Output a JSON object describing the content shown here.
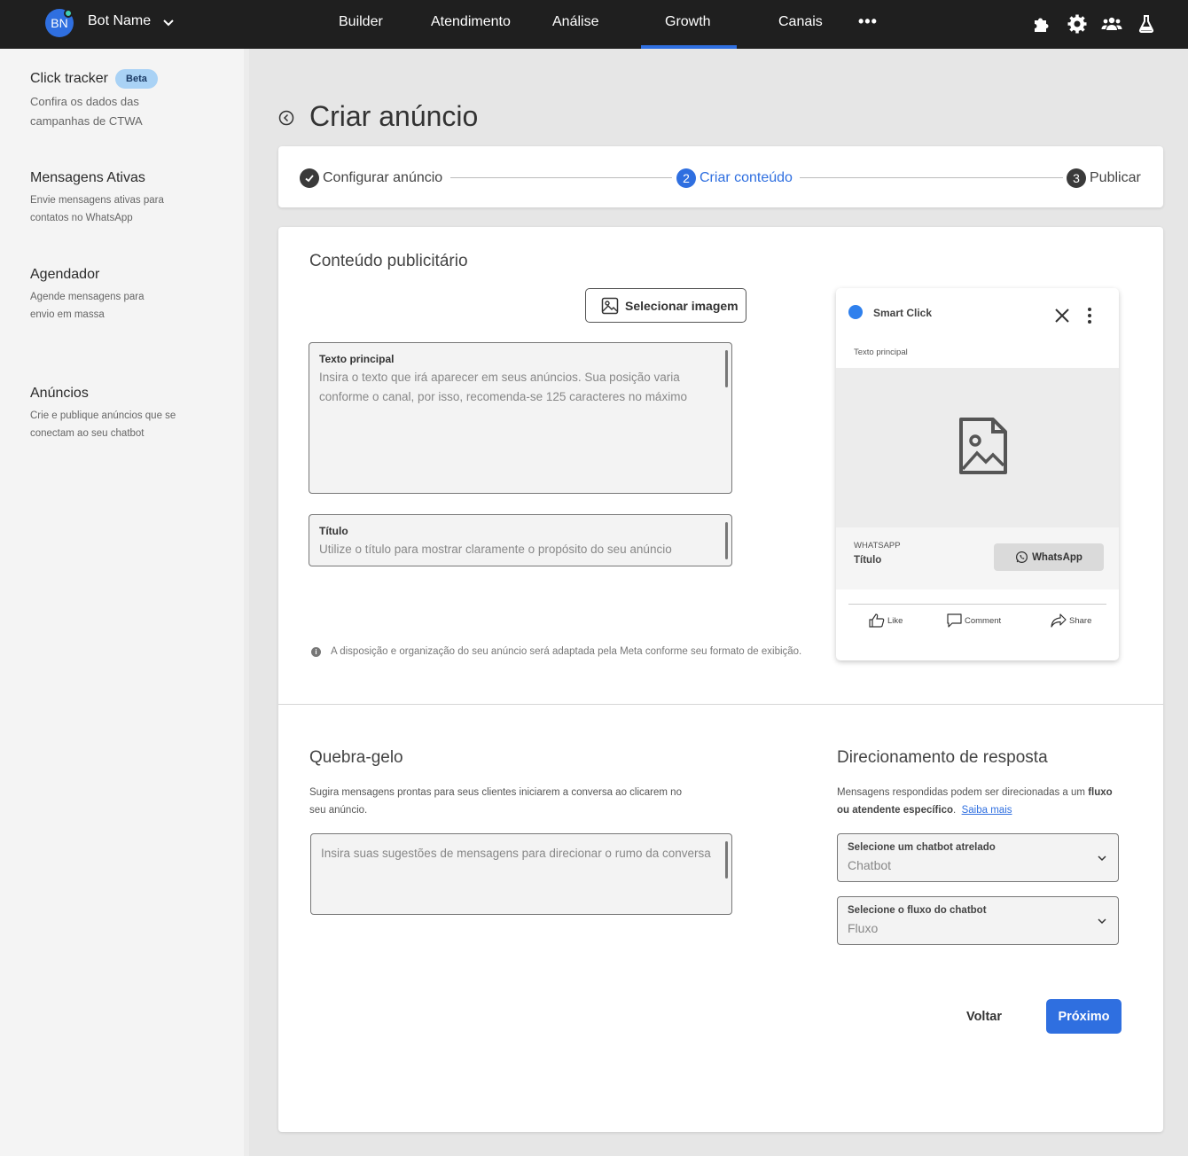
{
  "topbar": {
    "avatar_initials": "BN",
    "bot_name": "Bot Name",
    "nav": [
      "Builder",
      "Atendimento",
      "Análise",
      "Growth",
      "Canais"
    ],
    "active_nav": "Growth",
    "more": "•••",
    "icons": [
      "puzzle-icon",
      "gear-icon",
      "team-icon",
      "flask-icon"
    ]
  },
  "sidebar": {
    "items": [
      {
        "title": "Click tracker",
        "badge": "Beta",
        "desc": "Confira os dados das campanhas de CTWA"
      },
      {
        "title": "Mensagens Ativas",
        "desc": "Envie mensagens ativas para contatos no WhatsApp"
      },
      {
        "title": "Agendador",
        "desc": "Agende mensagens para envio em massa"
      },
      {
        "title": "Anúncios",
        "desc": "Crie e publique anúncios que se conectam ao seu chatbot"
      }
    ]
  },
  "page": {
    "title": "Criar anúncio"
  },
  "stepper": {
    "steps": [
      {
        "label": "Configurar anúncio",
        "number": "✓"
      },
      {
        "label": "Criar conteúdo",
        "number": "2"
      },
      {
        "label": "Publicar",
        "number": "3"
      }
    ]
  },
  "ad_content": {
    "section_title": "Conteúdo publicitário",
    "select_image": "Selecionar imagem",
    "main_text": {
      "label": "Texto principal",
      "placeholder": "Insira o texto que irá aparecer em seus anúncios. Sua posição varia conforme o canal, por isso, recomenda-se 125 caracteres no máximo"
    },
    "title_field": {
      "label": "Título",
      "placeholder": "Utilize o título para mostrar claramente o propósito do seu anúncio"
    },
    "info": "A disposição e organização do seu anúncio será adaptada pela Meta conforme seu formato de exibição."
  },
  "preview": {
    "page_name": "Smart Click",
    "main_text": "Texto principal",
    "channel": "WHATSAPP",
    "title": "Título",
    "cta": "WhatsApp",
    "actions": [
      "Like",
      "Comment",
      "Share"
    ]
  },
  "icebreaker": {
    "title": "Quebra-gelo",
    "desc": "Sugira mensagens prontas para seus clientes iniciarem a conversa ao clicarem no seu anúncio.",
    "placeholder": "Insira suas sugestões de mensagens para direcionar o rumo da conversa"
  },
  "routing": {
    "title": "Direcionamento de resposta",
    "desc_prefix": "Mensagens respondidas podem ser direcionadas a um ",
    "desc_bold1": "fluxo",
    "desc_mid": "ou atendente específico",
    "desc_dot": ".",
    "link": "Saiba mais",
    "chatbot_select": {
      "label": "Selecione um chatbot atrelado",
      "value": "Chatbot"
    },
    "flow_select": {
      "label": "Selecione o fluxo do chatbot",
      "value": "Fluxo"
    }
  },
  "footer": {
    "back": "Voltar",
    "next": "Próximo"
  },
  "colors": {
    "accent": "#2f6fe0",
    "topbar": "#1f1f1f"
  }
}
